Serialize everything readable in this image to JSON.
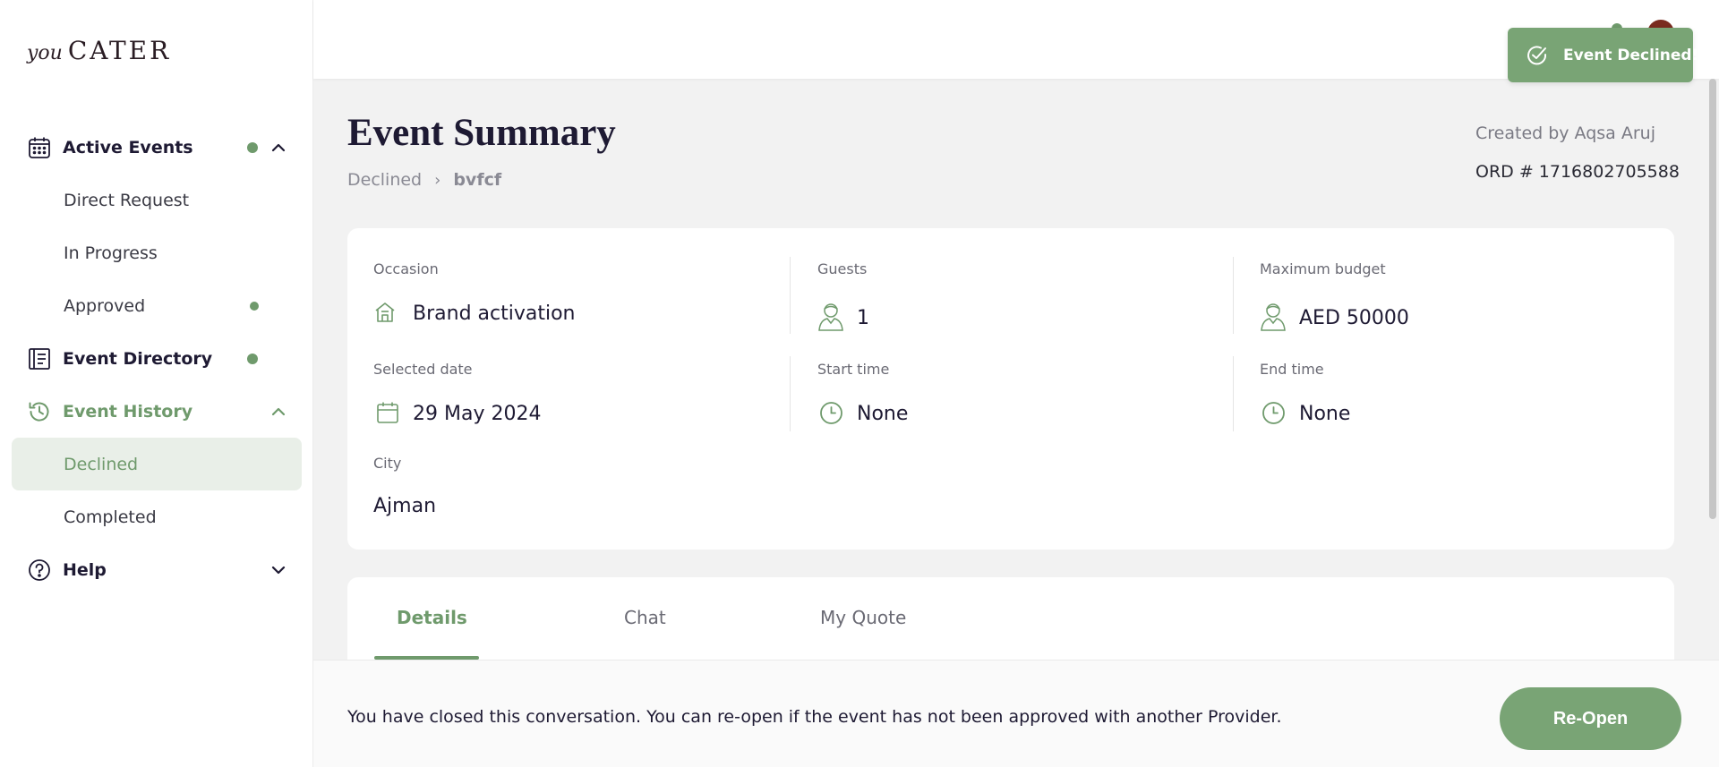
{
  "brand": {
    "prefix": "you",
    "name": "CATER"
  },
  "sidebar": {
    "active_events": {
      "label": "Active Events",
      "items": [
        {
          "label": "Direct Request"
        },
        {
          "label": "In Progress"
        },
        {
          "label": "Approved"
        }
      ]
    },
    "event_directory": {
      "label": "Event Directory"
    },
    "event_history": {
      "label": "Event History",
      "items": [
        {
          "label": "Declined"
        },
        {
          "label": "Completed"
        }
      ]
    },
    "help": {
      "label": "Help"
    }
  },
  "toast": {
    "message": "Event Declined!"
  },
  "header": {
    "title": "Event Summary",
    "breadcrumb": [
      "Declined",
      "bvfcf"
    ],
    "created_by_label": "Created by",
    "created_by_name": "Aqsa Aruj",
    "order": "ORD # 1716802705588"
  },
  "summary": {
    "occasion": {
      "label": "Occasion",
      "value": "Brand activation"
    },
    "guests": {
      "label": "Guests",
      "value": "1"
    },
    "budget": {
      "label": "Maximum budget",
      "value": "AED 50000"
    },
    "date": {
      "label": "Selected date",
      "value": "29 May 2024"
    },
    "start_time": {
      "label": "Start time",
      "value": "None"
    },
    "end_time": {
      "label": "End time",
      "value": "None"
    },
    "city": {
      "label": "City",
      "value": "Ajman"
    }
  },
  "tabs": [
    {
      "label": "Details"
    },
    {
      "label": "Chat"
    },
    {
      "label": "My Quote"
    }
  ],
  "footer": {
    "message": "You have closed this conversation. You can re-open if the event has not been approved with another Provider.",
    "button": "Re-Open"
  },
  "colors": {
    "accent": "#79a475",
    "accent_text": "#6f9a6c",
    "heading": "#1e1a33"
  }
}
